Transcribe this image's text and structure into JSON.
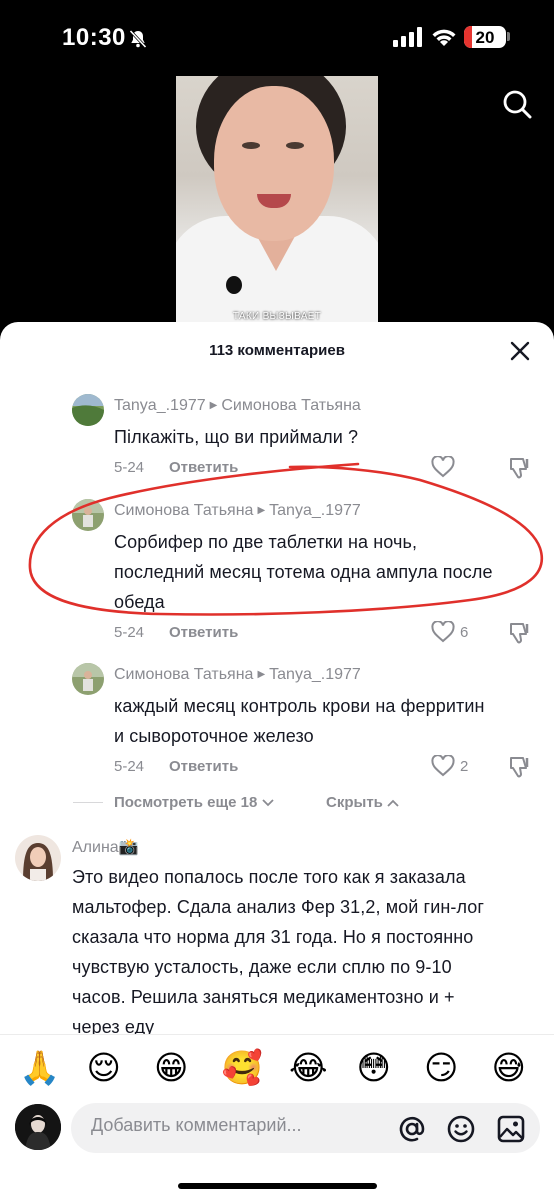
{
  "status_bar": {
    "time": "10:30",
    "battery": "20",
    "battery_level": 0.2
  },
  "video": {
    "caption": "ТАКИ ВЫЗЫВАЕТ"
  },
  "comments_sheet": {
    "title": "113 комментариев",
    "reply_label": "Ответить",
    "replies": [
      {
        "author": "Tanya_.1977",
        "reply_to": "Симонова Татьяна",
        "lines": [
          "Пілкажіть, що ви приймали ?"
        ],
        "date": "5-24",
        "likes": ""
      },
      {
        "author": "Симонова Татьяна",
        "reply_to": "Tanya_.1977",
        "lines": [
          "Сорбифер по две таблетки на ночь,",
          "последний месяц тотема одна ампула после",
          "обеда"
        ],
        "date": "5-24",
        "likes": "6"
      },
      {
        "author": "Симонова Татьяна",
        "reply_to": "Tanya_.1977",
        "lines": [
          "каждый месяц контроль крови на ферритин",
          "и сывороточное железо"
        ],
        "date": "5-24",
        "likes": "2"
      }
    ],
    "view_more": "Посмотреть еще 18",
    "hide": "Скрыть",
    "top_comment": {
      "author": "Алина📸",
      "lines": [
        "Это видео попалось после того как я заказала",
        "мальтофер. Сдала анализ Фер 31,2, мой гин-лог",
        "сказала что норма для 31 года. Но я постоянно",
        "чувствую усталость, даже если сплю по 9-10",
        "часов. Решила заняться медикаментозно и +",
        "через еду"
      ]
    }
  },
  "emoji_bar": [
    "🙏",
    "😌",
    "😁",
    "🥰",
    "😂",
    "😳",
    "😏",
    "😅"
  ],
  "comment_input": {
    "placeholder": "Добавить комментарий..."
  },
  "colors": {
    "annotation": "#e0302b",
    "battery_low": "#e5342f",
    "text": "#161823",
    "muted": "#8a8b91"
  },
  "icons": [
    "bell-slash-icon",
    "signal-icon",
    "wifi-icon",
    "search-icon",
    "close-icon",
    "heart-icon",
    "dislike-icon",
    "chevron-down-icon",
    "chevron-up-icon",
    "at-icon",
    "emoji-icon",
    "image-icon"
  ]
}
